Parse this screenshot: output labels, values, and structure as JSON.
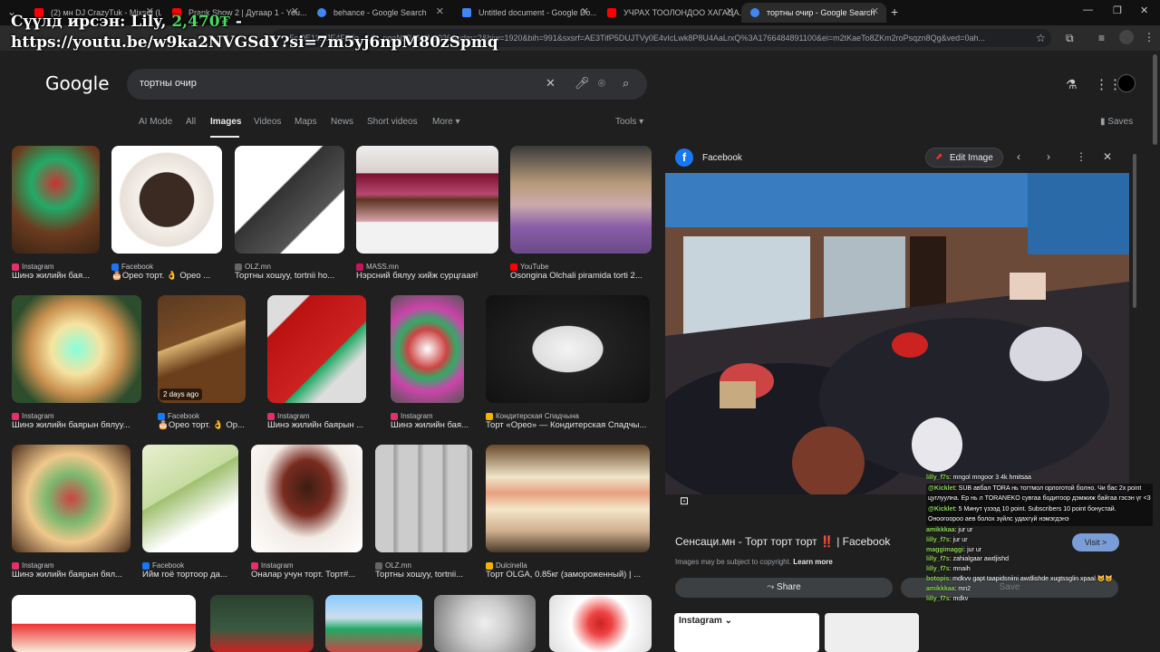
{
  "overlay": {
    "line1_prefix": "Сүүлд ирсэн: Lily, ",
    "price": "2,470₮",
    "line1_suffix": " -",
    "line2": "https://youtu.be/w9ka2NVGSdY?si=7m5yj6npM80zSpmq"
  },
  "tabs": [
    {
      "label": "(2) мн DJ CrazyTuk - Mixset (Li...",
      "color": "#ff0000"
    },
    {
      "label": "Prank Show 2 | Дугаар 1 - You...",
      "color": "#ff0000"
    },
    {
      "label": "behance - Google Search",
      "color": "#4285f4"
    },
    {
      "label": "Untitled document - Google Do...",
      "color": "#4285f4"
    },
    {
      "label": "УЧРАХ ТООЛОНДОО ХАГАЦА...",
      "color": "#ff0000"
    },
    {
      "label": "тортны очир - Google Search",
      "color": "#4285f4"
    }
  ],
  "address": {
    "url": "...5c-0E11...JE4F7dg...1C...pgeN1036MN1036&udm=2&biw=1920&bih=991&sxsrf=AE3TifP5DUJTVy0E4vIcLwk8P8U4AaLrxQ%3A1766484891100&ei=m2tKaeTo8ZKm2roPsqzn8Qg&ved=0ah..."
  },
  "google": {
    "logo": "Google",
    "query": "тортны очир"
  },
  "nav": {
    "items": [
      "AI Mode",
      "All",
      "Images",
      "Videos",
      "Maps",
      "News",
      "Short videos",
      "More ▾"
    ],
    "tools": "Tools ▾",
    "saves": "Saves"
  },
  "results": [
    {
      "source": "Instagram",
      "caption": "Шинэ жилийн бая...",
      "scolor": "#e1306c"
    },
    {
      "source": "Facebook",
      "caption": "🎂Орео торт. 👌 Орео ...",
      "scolor": "#1877f2"
    },
    {
      "source": "OLZ.mn",
      "caption": "Тортны хошуу, tortnii ho...",
      "scolor": "#666"
    },
    {
      "source": "MASS.mn",
      "caption": "Нэрсний бялуу хийж сурцгаая!",
      "scolor": "#c2185b"
    },
    {
      "source": "YouTube",
      "caption": "Osongina Olchali piramida torti 2...",
      "scolor": "#ff0000"
    },
    {
      "source": "Instagram",
      "caption": "Шинэ жилийн баярын бялуу...",
      "scolor": "#e1306c"
    },
    {
      "source": "Facebook",
      "caption": "🎂Орео торт. 👌 Ор...",
      "scolor": "#1877f2",
      "tag": "2 days ago"
    },
    {
      "source": "Instagram",
      "caption": "Шинэ жилийн баярын ...",
      "scolor": "#e1306c"
    },
    {
      "source": "Instagram",
      "caption": "Шинэ жилийн бая...",
      "scolor": "#e1306c"
    },
    {
      "source": "Кондитерская Спадчына",
      "caption": "Торт «Орео» — Кондитерская Спадчы...",
      "scolor": "#f4b400"
    },
    {
      "source": "Instagram",
      "caption": "Шинэ жилийн баярын бял...",
      "scolor": "#e1306c"
    },
    {
      "source": "Facebook",
      "caption": "Ийм гоё тортоор да...",
      "scolor": "#1877f2"
    },
    {
      "source": "Instagram",
      "caption": "Оналар учун торт. Торт#...",
      "scolor": "#e1306c"
    },
    {
      "source": "OLZ.mn",
      "caption": "Тортны хошуу, tortnii...",
      "scolor": "#666"
    },
    {
      "source": "Dulcinella",
      "caption": "Торт OLGA, 0.85кг (замороженный) | ...",
      "scolor": "#f4b400"
    }
  ],
  "panel": {
    "source": "Facebook",
    "edit": "Edit Image",
    "title": "Сенсаци.мн - Торт торт торт ‼️ | Facebook",
    "copyright": "Images may be subject to copyright.",
    "learn": "Learn more",
    "share": "Share",
    "visit": "Visit >",
    "save": "Save",
    "ig": "Instagram ⌄"
  },
  "chat": [
    {
      "user": "lilly_f7s",
      "msg": ": mngol mngoor 3 4k hmitsaa"
    },
    {
      "user": "@Kicklet",
      "msg": ": SUB авбал TORA нь тогтмол орлоготой болно. Чи бас 2x point цуглуулна. Ер нь л TORANEKO сувгаа бодитоор дэмжиж байгаа гэсэн үг <3",
      "hl": true
    },
    {
      "user": "@Kicklet",
      "msg": ": 5 Минут үзээд 10 point. Subscribers 10 point бонустай. Оноогоороо аев болох зүйлс удахгүй нэмэгдэнэ",
      "hl": true
    },
    {
      "user": "amikkkaa",
      "msg": ": jur ur"
    },
    {
      "user": "lilly_f7s",
      "msg": ": jur ur"
    },
    {
      "user": "maggimaggi",
      "msg": ": jur ur"
    },
    {
      "user": "lilly_f7s",
      "msg": ": zahialgaar awdjishd"
    },
    {
      "user": "lilly_f7s",
      "msg": ": mnaih"
    },
    {
      "user": "botopis",
      "msg": ": mdkvv gapt taapidsniini awdlishde xugtssglin xpaal 😺😺"
    },
    {
      "user": "amikkkaa",
      "msg": ": mn2"
    },
    {
      "user": "lilly_f7s",
      "msg": ": mdkv"
    }
  ]
}
